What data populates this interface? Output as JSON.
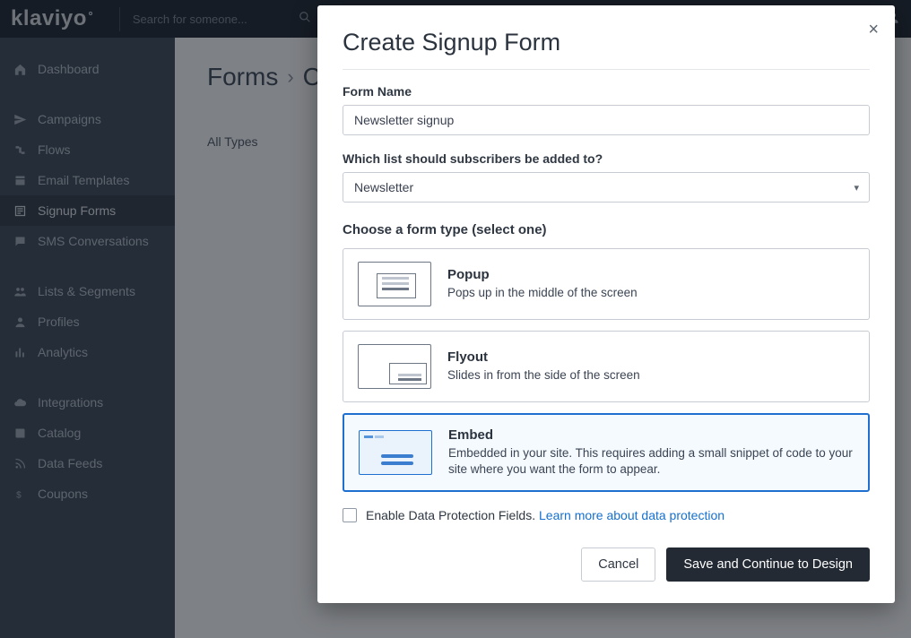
{
  "brand": "klaviyo",
  "search": {
    "placeholder": "Search for someone..."
  },
  "sidebar": {
    "items": [
      {
        "label": "Dashboard"
      },
      {
        "label": "Campaigns"
      },
      {
        "label": "Flows"
      },
      {
        "label": "Email Templates"
      },
      {
        "label": "Signup Forms"
      },
      {
        "label": "SMS Conversations"
      },
      {
        "label": "Lists & Segments"
      },
      {
        "label": "Profiles"
      },
      {
        "label": "Analytics"
      },
      {
        "label": "Integrations"
      },
      {
        "label": "Catalog"
      },
      {
        "label": "Data Feeds"
      },
      {
        "label": "Coupons"
      }
    ]
  },
  "main": {
    "breadcrumb_root": "Forms",
    "breadcrumb_current": "C",
    "tab_all": "All Types"
  },
  "modal": {
    "title": "Create Signup Form",
    "form_name_label": "Form Name",
    "form_name_value": "Newsletter signup",
    "list_label": "Which list should subscribers be added to?",
    "list_value": "Newsletter",
    "type_header": "Choose a form type (select one)",
    "types": {
      "popup": {
        "title": "Popup",
        "desc": "Pops up in the middle of the screen"
      },
      "flyout": {
        "title": "Flyout",
        "desc": "Slides in from the side of the screen"
      },
      "embed": {
        "title": "Embed",
        "desc": "Embedded in your site. This requires adding a small snippet of code to your site where you want the form to appear."
      }
    },
    "checkbox_label": "Enable Data Protection Fields. ",
    "checkbox_link": "Learn more about data protection",
    "cancel": "Cancel",
    "save": "Save and Continue to Design"
  }
}
